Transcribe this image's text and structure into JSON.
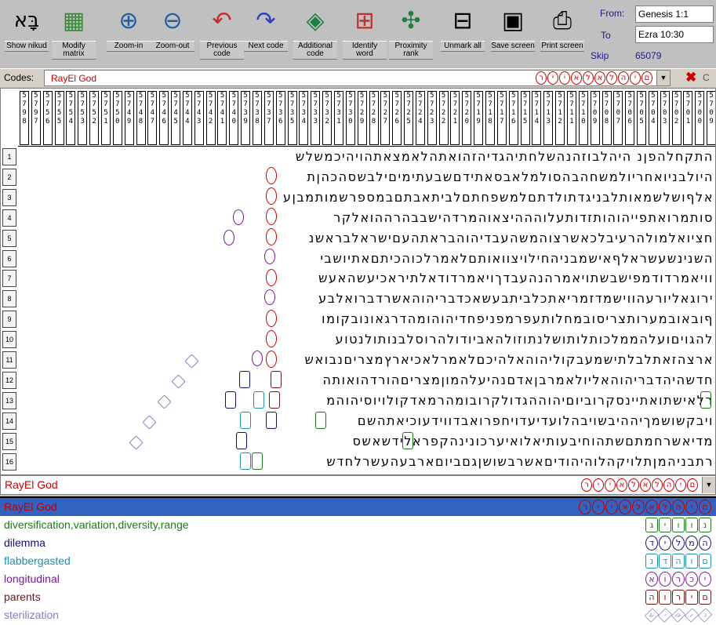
{
  "toolbar": {
    "buttons": [
      {
        "label": "Show nikud",
        "icon": "nikud-icon"
      },
      {
        "label": "Modify matrix",
        "icon": "matrix-icon"
      },
      {
        "label": "Zoom-in",
        "icon": "zoom-in-icon"
      },
      {
        "label": "Zoom-out",
        "icon": "zoom-out-icon"
      },
      {
        "label": "Previous code",
        "icon": "previous-code-icon"
      },
      {
        "label": "Next code",
        "icon": "next-code-icon"
      },
      {
        "label": "Additional code",
        "icon": "additional-code-icon"
      },
      {
        "label": "Identify word",
        "icon": "identify-word-icon"
      },
      {
        "label": "Proximity rank",
        "icon": "proximity-icon"
      },
      {
        "label": "Unmark all",
        "icon": "unmark-icon"
      },
      {
        "label": "Save screen",
        "icon": "save-screen-icon"
      },
      {
        "label": "Print screen",
        "icon": "print-icon"
      }
    ],
    "from_label": "From:",
    "from_value": "Genesis 1:1",
    "to_label": "To",
    "to_value": "Ezra 10:30",
    "skip_label": "Skip",
    "skip_value": "65079"
  },
  "codes": {
    "label": "Codes:",
    "value": "RayEl God",
    "hebrew_letters": [
      "ר",
      "י",
      "י",
      "א",
      "ל",
      "א",
      "ל",
      "ה",
      "י",
      "ם"
    ],
    "close_label": "C"
  },
  "grid": {
    "column_headers": [
      "5798",
      "5797",
      "5756",
      "5755",
      "5754",
      "5753",
      "5752",
      "5751",
      "5750",
      "5749",
      "5748",
      "5747",
      "5746",
      "5745",
      "5744",
      "5743",
      "5742",
      "5741",
      "5740",
      "5739",
      "5738",
      "5737",
      "5736",
      "5735",
      "5734",
      "5733",
      "5732",
      "5731",
      "5730",
      "5729",
      "5728",
      "5727",
      "5726",
      "5725",
      "5724",
      "5723",
      "5722",
      "5721",
      "5720",
      "5719",
      "5718",
      "5717",
      "5716",
      "5715",
      "5714",
      "5713",
      "5712",
      "5711",
      "5710",
      "5709",
      "5708",
      "5707",
      "5706",
      "5705",
      "5704",
      "5703",
      "5702",
      "5701",
      "5700",
      "5709"
    ],
    "rows": [
      {
        "n": "1",
        "text": "התקחלהפןנ היהלבוזהנהשלחתיהגדיהזהואתהלאמצאתהויהיכמשלש"
      },
      {
        "n": "2",
        "text": "היולבניואחריולמשחהבהסולמלאבסאתידםשבעתימיםילבשסהכהןת"
      },
      {
        "n": "3",
        "text": "אלףושלשמאותלבניגדתולדתםלמשפחתםלביתאבתםבמספרשמותמבןע"
      },
      {
        "n": "4",
        "text": "סותמרואתפייהוהותזדותעלוהההיצאוהמרדהישבבהרההואלקר"
      },
      {
        "n": "5",
        "text": "חציואלמולהרעיבלכאשרצוהמשהעבדיהוהבראתהעםישראלבראשנ"
      },
      {
        "n": "6",
        "text": "השנינשעשראלףאישמבניהחילויצוואותםלאמרלכוהכיתםאתיושבי"
      },
      {
        "n": "7",
        "text": "וויאמרדודמפישבשתויאמרהנהעבדךויאמרדודאלתיראכיעשהאעש"
      },
      {
        "n": "8",
        "text": "ירוגאליורעהווישמדזמריאתכלביתבעשאכדבריהוהאשרדברואלבע"
      },
      {
        "n": "9",
        "text": "ףובאובמערותצריסובמחלותעפרמפניפחדיהוהומהדרגאונובקומו"
      },
      {
        "n": "10",
        "text": "להגויםועלהממלכותלותושלנתוזולהאביודולהרוסלבנותולנטוע"
      },
      {
        "n": "11",
        "text": "ארצהזאתלבלתישמעבקוליהוהאלהיכםלאמרלאכיארץמצריםנבואש"
      },
      {
        "n": "12",
        "text": "חדשהיהדבריהוהאליולאמרבןאדםנהיעלהמוןמצריםהורדהואותה"
      },
      {
        "n": "13",
        "text": "רלאישתואתיינסקרוביוםיהוההגדולקרובומהרמאדקולויוסיהוהמ"
      },
      {
        "n": "14",
        "text": "ויבקשושמךיההיבשויבהלועדיעדויחפרואבדווידעוכיאתהשם"
      },
      {
        "n": "15",
        "text": "מדיאשרחמתםשתהוחיבעותיאלואיערכונינהקפראלידשאשס"
      },
      {
        "n": "16",
        "text": "רתבניהמןתלויקהלוהיהודיםאשרבשושןגםביוםארבעהעשרלחדש"
      }
    ]
  },
  "current_code": {
    "value": "RayEl God",
    "hebrew_letters": [
      "ר",
      "י",
      "י",
      "א",
      "ל",
      "א",
      "ל",
      "ה",
      "י",
      "ם"
    ]
  },
  "code_list": [
    {
      "label": "RayEl God",
      "color": "#c00000",
      "selected": true,
      "letters": [
        "ר",
        "י",
        "י",
        "א",
        "ל",
        "א",
        "ל",
        "ה",
        "י",
        "ם"
      ],
      "shape": "circle"
    },
    {
      "label": "diversification,variation,diversity,range",
      "color": "#1a7a1a",
      "selected": false,
      "letters": [
        "ג",
        "י",
        "ו",
        "ו",
        "נ"
      ],
      "shape": "box"
    },
    {
      "label": "dilemma",
      "color": "#10107a",
      "selected": false,
      "letters": [
        "ד",
        "י",
        "ל",
        "מ",
        "ה"
      ],
      "shape": "circle"
    },
    {
      "label": "flabbergasted",
      "color": "#1a8fb0",
      "selected": false,
      "letters": [
        "נ",
        "ד",
        "ה",
        "ו",
        "ם"
      ],
      "shape": "box"
    },
    {
      "label": "longitudinal",
      "color": "#7a1a9a",
      "selected": false,
      "letters": [
        "א",
        "ו",
        "ר",
        "כ",
        "י"
      ],
      "shape": "circle"
    },
    {
      "label": "parents",
      "color": "#6a1a1a",
      "selected": false,
      "letters": [
        "ה",
        "ו",
        "ר",
        "י",
        "ם"
      ],
      "shape": "box"
    },
    {
      "label": "sterilization",
      "color": "#8080c0",
      "selected": false,
      "letters": [
        "ע",
        "י",
        "ק",
        "ו",
        "ר"
      ],
      "shape": "diamond"
    }
  ]
}
